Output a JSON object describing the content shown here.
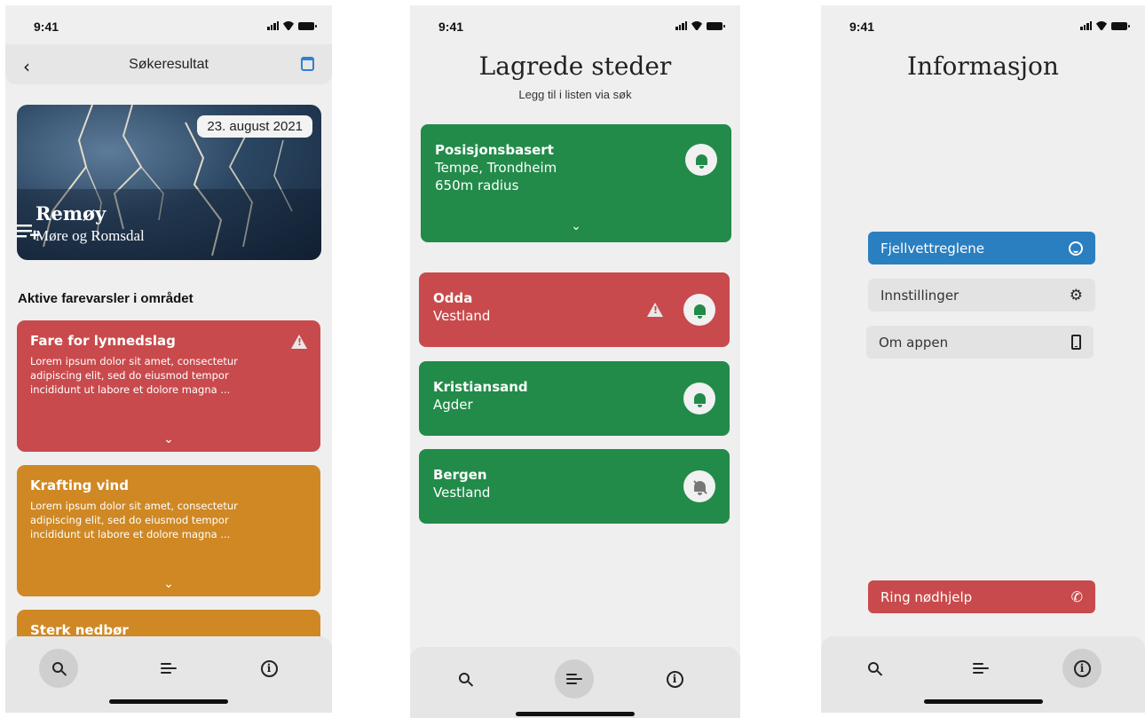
{
  "status": {
    "time": "9:41"
  },
  "screen1": {
    "header_title": "Søkeresultat",
    "hero": {
      "date": "23. august 2021",
      "place": "Remøy",
      "region": "Møre og Romsdal"
    },
    "section_title": "Aktive farevarsler i området",
    "warnings": [
      {
        "title": "Fare for lynnedslag",
        "text": "Lorem ipsum dolor sit amet, consectetur adipiscing elit, sed do eiusmod tempor incididunt ut labore et dolore magna ...",
        "color": "#c94a4c"
      },
      {
        "title": "Krafting vind",
        "text": "Lorem ipsum dolor sit amet, consectetur adipiscing elit, sed do eiusmod tempor incididunt ut labore et dolore magna ...",
        "color": "#cf8824"
      },
      {
        "title": "Sterk nedbør",
        "color": "#cf8824"
      }
    ],
    "active_tab": "search"
  },
  "screen2": {
    "title": "Lagrede steder",
    "subtitle": "Legg til i listen via søk",
    "position_card": {
      "name": "Posisjonsbasert",
      "line1": "Tempe, Trondheim",
      "line2": "650m radius"
    },
    "locations": [
      {
        "name": "Odda",
        "region": "Vestland",
        "warning": true,
        "notify": true
      },
      {
        "name": "Kristiansand",
        "region": "Agder",
        "warning": false,
        "notify": true
      },
      {
        "name": "Bergen",
        "region": "Vestland",
        "warning": false,
        "notify": false
      }
    ],
    "active_tab": "list"
  },
  "screen3": {
    "title": "Informasjon",
    "menu": [
      {
        "label": "Fjellvettreglene",
        "icon": "smiley-icon"
      },
      {
        "label": "Innstillinger",
        "icon": "gear-icon"
      },
      {
        "label": "Om appen",
        "icon": "phone-device-icon"
      }
    ],
    "emergency_label": "Ring nødhjelp",
    "active_tab": "info"
  },
  "colors": {
    "green": "#228b4a",
    "red": "#c94a4c",
    "orange": "#cf8824",
    "blue": "#2a7fc1",
    "background": "#efefef"
  }
}
